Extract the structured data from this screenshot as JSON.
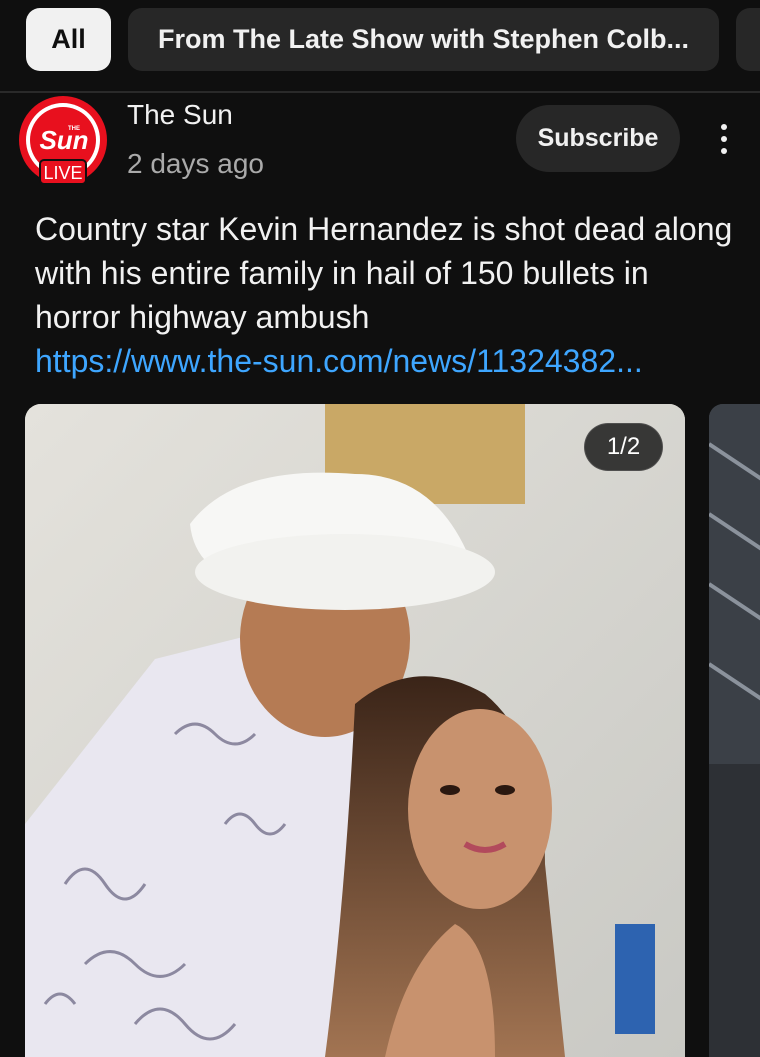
{
  "chips": {
    "all": "All",
    "late_show": "From The Late Show with Stephen Colb..."
  },
  "channel": {
    "avatar_brand": "Sun",
    "avatar_top_text": "THE",
    "avatar_badge": "LIVE",
    "name": "The Sun",
    "posted": "2 days ago",
    "subscribe_label": "Subscribe"
  },
  "post": {
    "text": "Country star Kevin Hernandez is shot dead along with his entire family in hail of 150 bullets in horror highway ambush",
    "link": "https://www.the-sun.com/news/11324382..."
  },
  "carousel": {
    "counter": "1/2"
  },
  "colors": {
    "background": "#0f0f0f",
    "chip_selected": "#f1f1f1",
    "chip": "#272727",
    "link": "#3ea6ff",
    "brand_red": "#e8101e"
  },
  "icons": [
    "more-vert-icon"
  ]
}
